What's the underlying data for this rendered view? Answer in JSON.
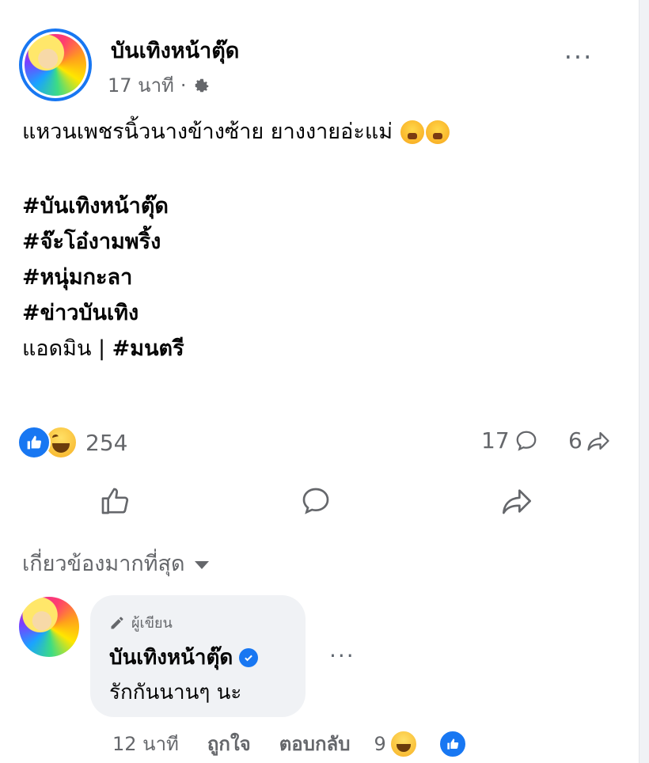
{
  "post": {
    "page_name": "บันเทิงหน้าตุ๊ด",
    "time": "17 นาที",
    "separator": "·",
    "audience_icon": "gear-icon",
    "more_label": "···",
    "text_line": "แหวนเพชรนิ้วนางข้างซ้าย ยางงายอ่ะแม่",
    "hashtags": [
      "#บันเทิงหน้าตุ๊ด",
      "#จ๊ะโอ๋งามพริ้ง",
      "#หนุ่มกะลา",
      "#ข่าวบันเทิง"
    ],
    "admin_prefix": "แอดมิน | ",
    "admin_tag": "#มนตรี"
  },
  "stats": {
    "reaction_count": "254",
    "comment_count": "17",
    "share_count": "6"
  },
  "comments_section": {
    "sort_label": "เกี่ยวข้องมากที่สุด"
  },
  "comment": {
    "author_badge": "ผู้เขียน",
    "name": "บันเทิงหน้าตุ๊ด",
    "text": "รักกันนานๆ นะ",
    "more_label": "···",
    "time": "12 นาที",
    "like_label": "ถูกใจ",
    "reply_label": "ตอบกลับ",
    "reaction_count": "9"
  },
  "colors": {
    "accent": "#1877f2",
    "secondary_text": "#65676b",
    "bubble": "#f0f2f5"
  }
}
